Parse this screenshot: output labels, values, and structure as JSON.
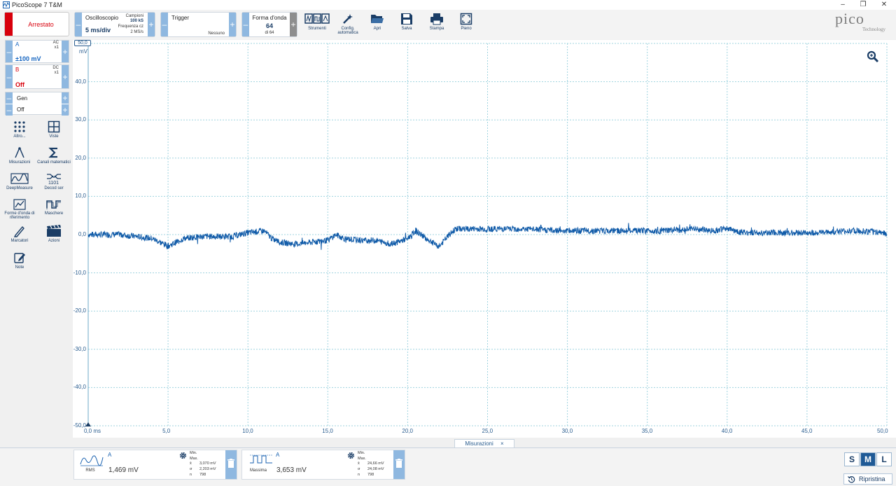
{
  "window": {
    "title": "PicoScope 7 T&M"
  },
  "toolbar": {
    "run_state": "Arrestato",
    "scope_mode": "Oscilloscopio",
    "timebase": "5 ms/div",
    "samples_label": "Campioni",
    "samples_value": "100 kS",
    "freq_label": "Frequenza cz",
    "freq_value": "2 MS/s",
    "trigger_label": "Trigger",
    "trigger_value": "Nessuno",
    "waveform_label": "Forma d'onda",
    "waveform_value": "64",
    "waveform_of": "di 64",
    "tools_label": "Strumenti",
    "autoconfig_label": "Config. automatica",
    "open_label": "Apri",
    "save_label": "Salva",
    "print_label": "Stampa",
    "full_label": "Pieno"
  },
  "logo": {
    "brand": "pico",
    "sub": "Technology"
  },
  "channels": [
    {
      "name": "A",
      "coupling": "AC",
      "probe": "x1",
      "range": "±100 mV",
      "color": "#1565c0"
    },
    {
      "name": "B",
      "coupling": "DC",
      "probe": "x1",
      "range": "Off",
      "color": "#d8000c"
    }
  ],
  "generator": {
    "label": "Gen",
    "state": "Off"
  },
  "sidebar": [
    {
      "label": "Altro...",
      "icon": "dots-grid-icon"
    },
    {
      "label": "Viste",
      "icon": "grid-view-icon"
    },
    {
      "label": "Misurazioni",
      "icon": "compass-icon"
    },
    {
      "label": "Canali matematici",
      "icon": "sigma-icon"
    },
    {
      "label": "DeepMeasure",
      "icon": "deepmeasure-icon"
    },
    {
      "label": "Decod ser",
      "icon": "serial-decode-icon"
    },
    {
      "label": "Forme d'onda di riferimento",
      "icon": "reference-waveform-icon"
    },
    {
      "label": "Maschere",
      "icon": "mask-icon"
    },
    {
      "label": "Marcatori",
      "icon": "pen-icon"
    },
    {
      "label": "Azioni",
      "icon": "clapper-icon"
    },
    {
      "label": "Note",
      "icon": "note-icon"
    }
  ],
  "plot": {
    "y_unit_value": "50,0",
    "y_unit": "mV",
    "x_unit": "ms",
    "y_ticks": [
      "40,0",
      "30,0",
      "20,0",
      "10,0",
      "0,0",
      "-10,0",
      "-20,0",
      "-30,0",
      "-40,0",
      "-50,0"
    ],
    "x_ticks": [
      "0,0",
      "5,0",
      "10,0",
      "15,0",
      "20,0",
      "25,0",
      "30,0",
      "35,0",
      "40,0",
      "45,0",
      "50,0"
    ],
    "trace_color": "#0f5aa8",
    "grid_color": "#9fd3df"
  },
  "chart_data": {
    "type": "line",
    "xlabel": "ms",
    "ylabel": "mV",
    "xlim": [
      0,
      50
    ],
    "ylim": [
      -50,
      50
    ],
    "x": [
      0,
      2,
      4,
      5,
      5.5,
      6,
      7,
      8,
      9,
      10,
      11,
      11.5,
      12,
      13,
      14,
      15,
      15.5,
      16,
      17,
      18,
      19,
      20,
      20.5,
      21,
      21.5,
      22,
      22.5,
      23,
      24,
      25,
      27,
      30,
      33,
      36,
      38,
      39,
      40,
      41,
      42,
      44,
      46,
      48,
      50
    ],
    "series": [
      {
        "values": [
          0,
          0,
          -1,
          -3,
          -2,
          -1,
          -0.5,
          -0.5,
          -0.5,
          0.5,
          1,
          -1,
          -2,
          -2.5,
          -2,
          -1.5,
          0,
          -1,
          -1.5,
          -1.5,
          -2.5,
          -1,
          1,
          -0.5,
          -2,
          -3,
          -0.5,
          1.5,
          1.5,
          1.5,
          1.5,
          1,
          1,
          1,
          1.5,
          1,
          1.5,
          0.5,
          0.5,
          0.5,
          0.5,
          1,
          0.5
        ]
      }
    ]
  },
  "measurements_tab": {
    "label": "Misurazioni",
    "close": "×"
  },
  "measurements": [
    {
      "channel": "A",
      "name": "RMS",
      "value": "1,469 mV",
      "stats": {
        "Min.": "775,6 µV",
        "Max.": "8,450 mV",
        "x̄": "3,070 mV",
        "σ": "2,203 mV",
        "n": "798"
      }
    },
    {
      "channel": "A",
      "name": "Massima",
      "value": "3,653 mV",
      "stats": {
        "Min.": "2,759 mV",
        "Max.": "99,59 mV",
        "x̄": "24,66 mV",
        "σ": "24,08 mV",
        "n": "798"
      }
    }
  ],
  "size_buttons": [
    "S",
    "M",
    "L"
  ],
  "reset_label": "Ripristina"
}
